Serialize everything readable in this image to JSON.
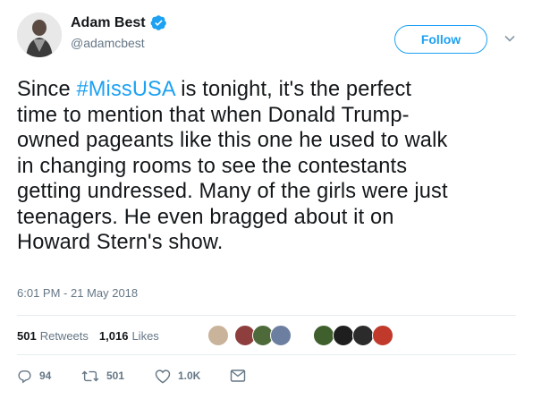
{
  "author": {
    "display_name": "Adam Best",
    "handle": "@adamcbest",
    "verified": true
  },
  "follow_label": "Follow",
  "tweet": {
    "text_before": "Since ",
    "hashtag": "#MissUSA",
    "text_after": " is tonight, it's the perfect\ntime to mention that when Donald Trump-\nowned pageants like this one he used to walk\nin changing rooms to see the contestants\ngetting undressed. Many of the girls were just\nteenagers. He even bragged about it on\nHoward Stern's show."
  },
  "timestamp": "6:01 PM - 21 May 2018",
  "stats": {
    "retweets_count": "501",
    "retweets_label": "Retweets",
    "likes_count": "1,016",
    "likes_label": "Likes"
  },
  "actions": {
    "reply_count": "94",
    "retweet_count": "501",
    "like_count": "1.0K"
  },
  "colors": {
    "accent": "#1da1f2",
    "muted": "#657786",
    "text": "#14171a",
    "divider": "#e6ecf0"
  },
  "icons": [
    "verified-badge-icon",
    "chevron-down-icon",
    "reply-icon",
    "retweet-icon",
    "like-icon",
    "direct-message-icon"
  ]
}
